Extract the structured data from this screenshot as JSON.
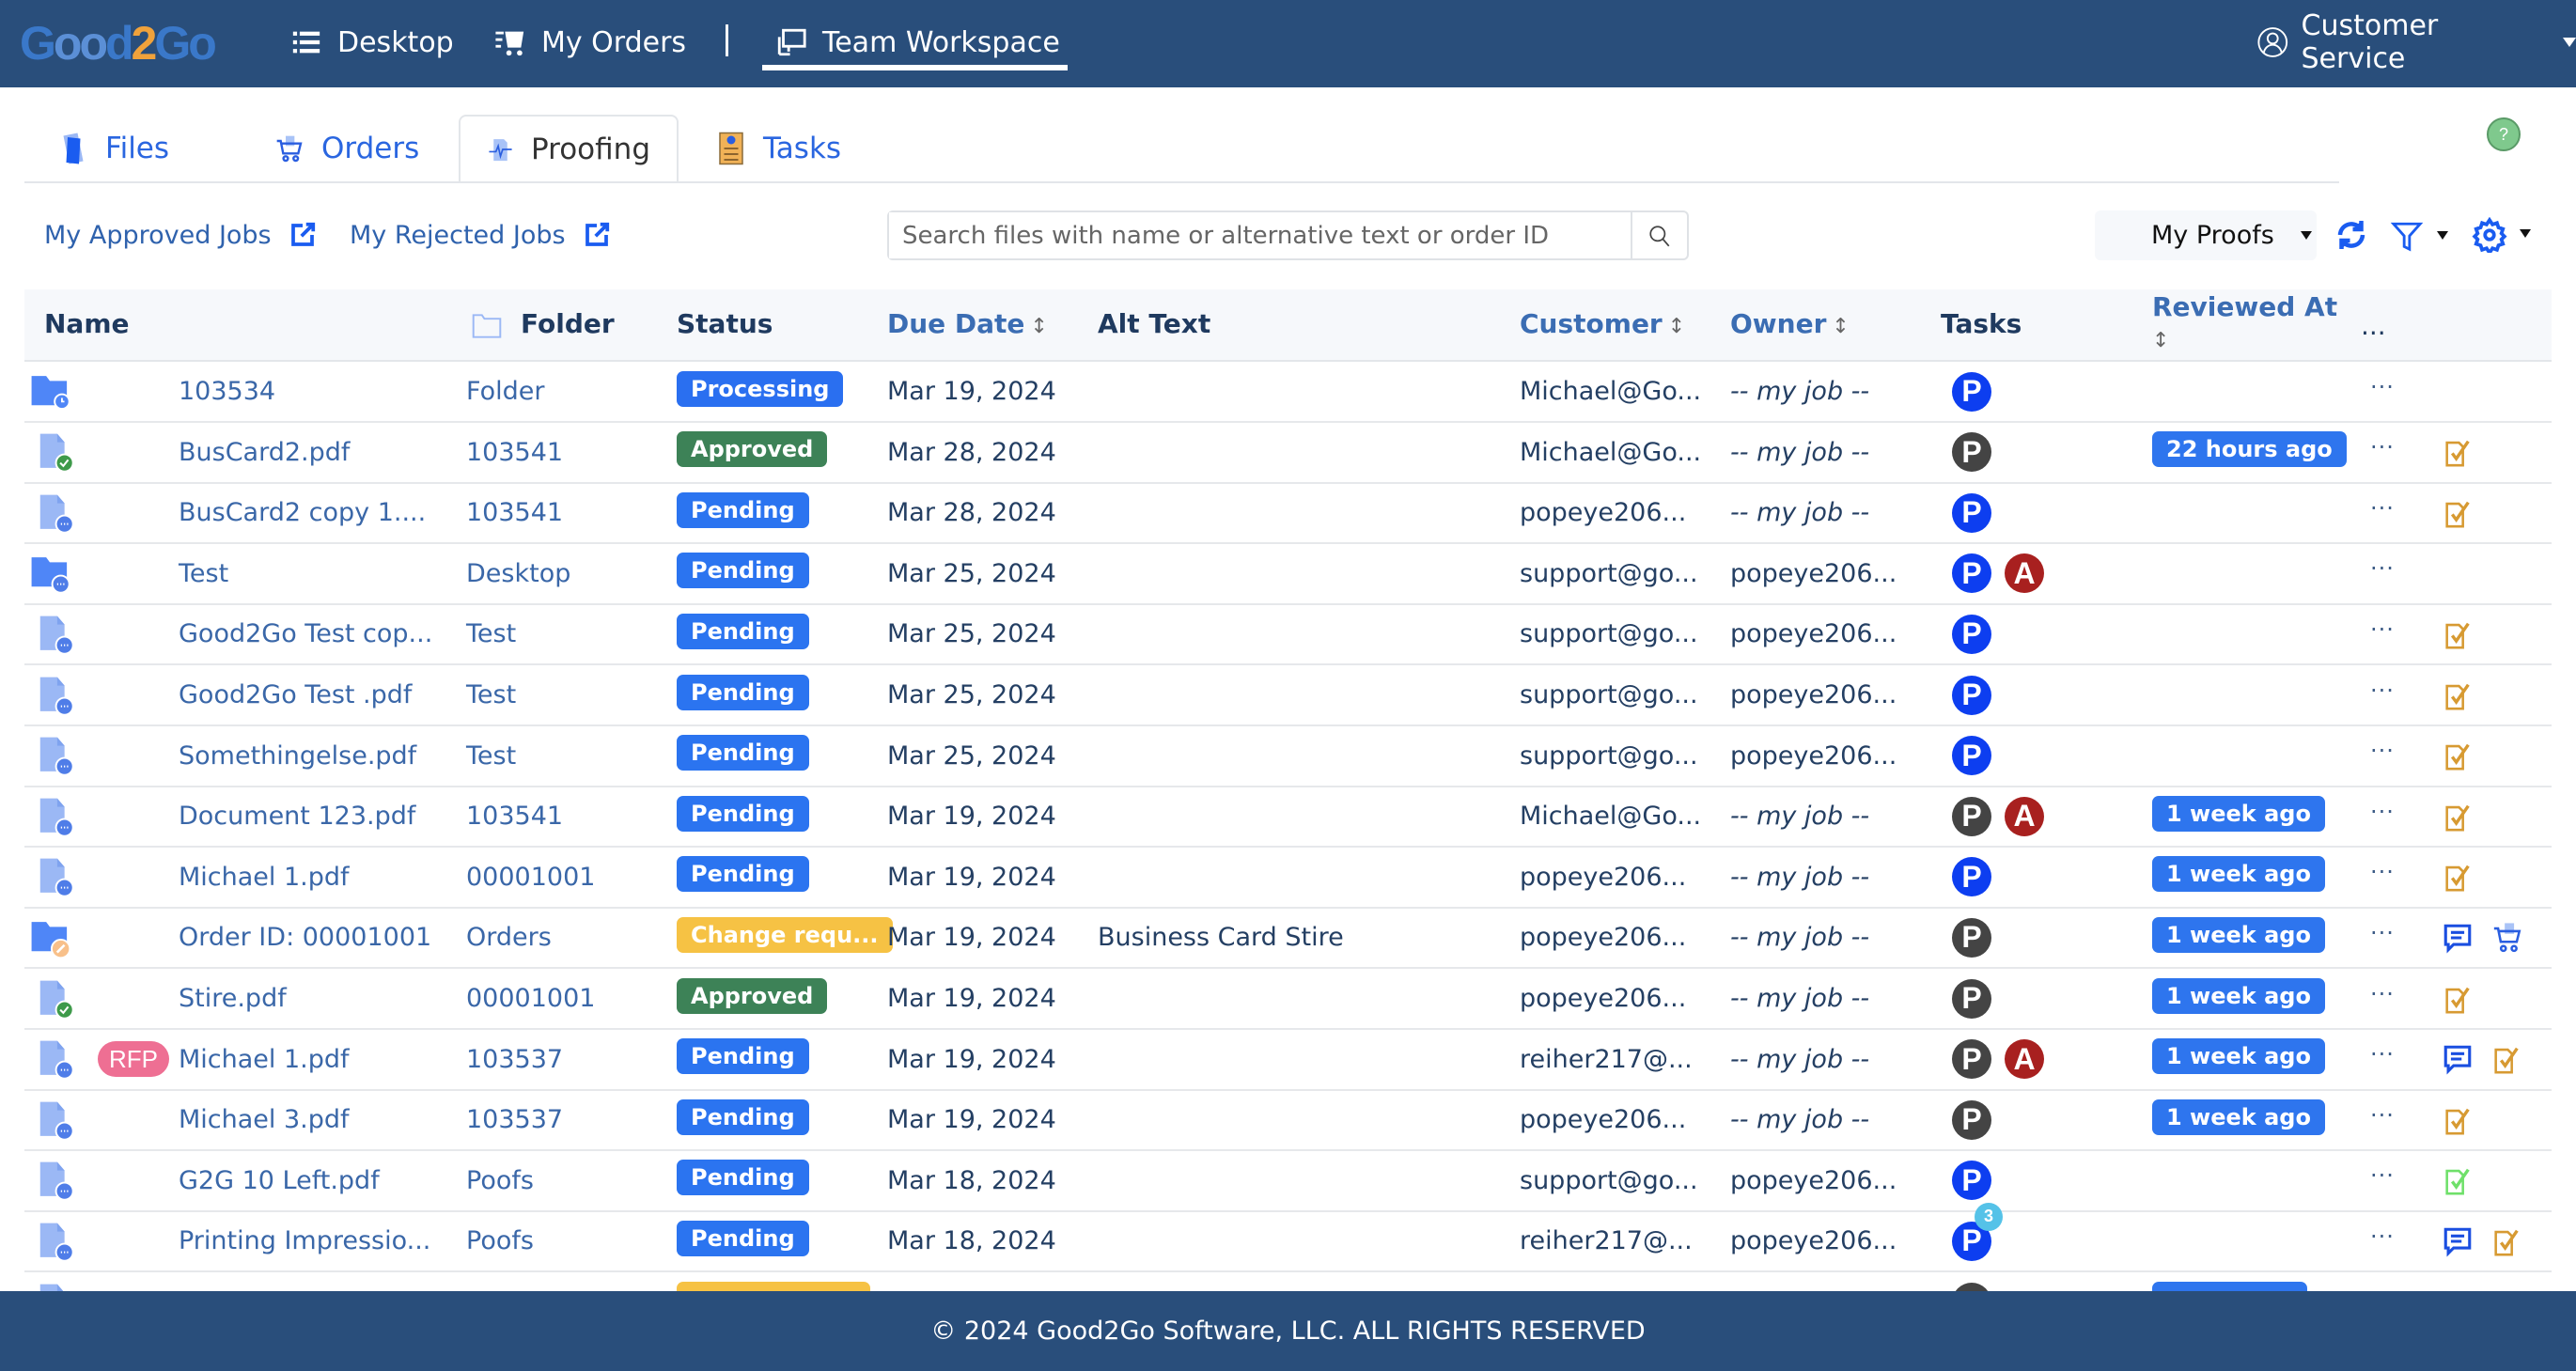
{
  "app": {
    "logo": "Good2Go"
  },
  "nav": {
    "items": [
      {
        "label": "Desktop",
        "icon": "list-icon"
      },
      {
        "label": "My Orders",
        "icon": "orders-cart-icon"
      },
      {
        "label": "Team Workspace",
        "icon": "workspace-icon",
        "active": true
      }
    ],
    "user_label": "Customer Service"
  },
  "tabs": [
    {
      "label": "Files",
      "icon": "files-icon"
    },
    {
      "label": "Orders",
      "icon": "cart-icon"
    },
    {
      "label": "Proofing",
      "icon": "proofing-icon",
      "active": true
    },
    {
      "label": "Tasks",
      "icon": "tasks-icon"
    }
  ],
  "help_label": "?",
  "toolbar": {
    "approved_jobs": "My Approved Jobs",
    "rejected_jobs": "My Rejected Jobs",
    "search_placeholder": "Search files with name or alternative text or order ID",
    "search_value": "",
    "view_select": "My Proofs"
  },
  "colors": {
    "header_bg": "#294e7b",
    "pending": "#2b74f0",
    "processing": "#2a6ff0",
    "approved": "#3d8257",
    "change_requested": "#f6c244",
    "reviewed": "#2e75ee",
    "task_p_active": "#0d3ef0",
    "task_p_done": "#444444",
    "task_a": "#a8201f"
  },
  "table": {
    "columns": [
      "Name",
      "Folder",
      "Status",
      "Due Date",
      "Alt Text",
      "Customer",
      "Owner",
      "Tasks",
      "Reviewed At",
      "..."
    ],
    "sort_arrow": "↕",
    "rows": [
      {
        "icon": "folder-processing",
        "name": "103534",
        "folder": "Folder",
        "status": "Processing",
        "due": "Mar 19, 2024",
        "alt": "",
        "customer": "Michael@Go...",
        "owner": "-- my job --",
        "tasks": [
          {
            "t": "P",
            "s": "active"
          }
        ],
        "reviewed": "",
        "actions": []
      },
      {
        "icon": "file-approved",
        "name": "BusCard2.pdf",
        "folder": "103541",
        "status": "Approved",
        "due": "Mar 28, 2024",
        "alt": "",
        "customer": "Michael@Go...",
        "owner": "-- my job --",
        "tasks": [
          {
            "t": "P",
            "s": "done"
          }
        ],
        "reviewed": "22 hours ago",
        "actions": [
          "approve"
        ]
      },
      {
        "icon": "file-pending",
        "name": "BusCard2 copy 1....",
        "folder": "103541",
        "status": "Pending",
        "due": "Mar 28, 2024",
        "alt": "",
        "customer": "popeye206...",
        "owner": "-- my job --",
        "tasks": [
          {
            "t": "P",
            "s": "active"
          }
        ],
        "reviewed": "",
        "actions": [
          "approve"
        ]
      },
      {
        "icon": "folder-pending",
        "name": "Test",
        "folder": "Desktop",
        "status": "Pending",
        "due": "Mar 25, 2024",
        "alt": "",
        "customer": "support@go...",
        "owner": "popeye206...",
        "tasks": [
          {
            "t": "P",
            "s": "active"
          },
          {
            "t": "A",
            "s": "alert"
          }
        ],
        "reviewed": "",
        "actions": []
      },
      {
        "icon": "file-pending",
        "name": "Good2Go Test cop...",
        "folder": "Test",
        "status": "Pending",
        "due": "Mar 25, 2024",
        "alt": "",
        "customer": "support@go...",
        "owner": "popeye206...",
        "tasks": [
          {
            "t": "P",
            "s": "active"
          }
        ],
        "reviewed": "",
        "actions": [
          "approve"
        ]
      },
      {
        "icon": "file-pending",
        "name": "Good2Go Test .pdf",
        "folder": "Test",
        "status": "Pending",
        "due": "Mar 25, 2024",
        "alt": "",
        "customer": "support@go...",
        "owner": "popeye206...",
        "tasks": [
          {
            "t": "P",
            "s": "active"
          }
        ],
        "reviewed": "",
        "actions": [
          "approve"
        ]
      },
      {
        "icon": "file-pending",
        "name": "Somethingelse.pdf",
        "folder": "Test",
        "status": "Pending",
        "due": "Mar 25, 2024",
        "alt": "",
        "customer": "support@go...",
        "owner": "popeye206...",
        "tasks": [
          {
            "t": "P",
            "s": "active"
          }
        ],
        "reviewed": "",
        "actions": [
          "approve"
        ]
      },
      {
        "icon": "file-pending",
        "name": "Document 123.pdf",
        "folder": "103541",
        "status": "Pending",
        "due": "Mar 19, 2024",
        "alt": "",
        "customer": "Michael@Go...",
        "owner": "-- my job --",
        "tasks": [
          {
            "t": "P",
            "s": "done"
          },
          {
            "t": "A",
            "s": "alert"
          }
        ],
        "reviewed": "1 week ago",
        "actions": [
          "approve"
        ]
      },
      {
        "icon": "file-pending",
        "name": "Michael 1.pdf",
        "folder": "00001001",
        "status": "Pending",
        "due": "Mar 19, 2024",
        "alt": "",
        "customer": "popeye206...",
        "owner": "-- my job --",
        "tasks": [
          {
            "t": "P",
            "s": "active"
          }
        ],
        "reviewed": "1 week ago",
        "actions": [
          "approve"
        ]
      },
      {
        "icon": "folder-change",
        "name": "Order ID: 00001001",
        "folder": "Orders",
        "status": "Change requ...",
        "due": "Mar 19, 2024",
        "alt": "Business Card Stire",
        "customer": "popeye206...",
        "owner": "-- my job --",
        "tasks": [
          {
            "t": "P",
            "s": "done"
          }
        ],
        "reviewed": "1 week ago",
        "actions": [
          "comment",
          "cart"
        ]
      },
      {
        "icon": "file-approved",
        "name": "Stire.pdf",
        "folder": "00001001",
        "status": "Approved",
        "due": "Mar 19, 2024",
        "alt": "",
        "customer": "popeye206...",
        "owner": "-- my job --",
        "tasks": [
          {
            "t": "P",
            "s": "done"
          }
        ],
        "reviewed": "1 week ago",
        "actions": [
          "approve"
        ]
      },
      {
        "icon": "file-pending",
        "tag": "RFP",
        "name": "Michael 1.pdf",
        "folder": "103537",
        "status": "Pending",
        "due": "Mar 19, 2024",
        "alt": "",
        "customer": "reiher217@...",
        "owner": "-- my job --",
        "tasks": [
          {
            "t": "P",
            "s": "done"
          },
          {
            "t": "A",
            "s": "alert"
          }
        ],
        "reviewed": "1 week ago",
        "actions": [
          "comment",
          "approve"
        ]
      },
      {
        "icon": "file-pending",
        "name": "Michael 3.pdf",
        "folder": "103537",
        "status": "Pending",
        "due": "Mar 19, 2024",
        "alt": "",
        "customer": "popeye206...",
        "owner": "-- my job --",
        "tasks": [
          {
            "t": "P",
            "s": "done"
          }
        ],
        "reviewed": "1 week ago",
        "actions": [
          "approve"
        ]
      },
      {
        "icon": "file-pending",
        "name": "G2G 10 Left.pdf",
        "folder": "Poofs",
        "status": "Pending",
        "due": "Mar 18, 2024",
        "alt": "",
        "customer": "support@go...",
        "owner": "popeye206...",
        "tasks": [
          {
            "t": "P",
            "s": "active"
          }
        ],
        "reviewed": "",
        "actions": [
          "approve-done"
        ]
      },
      {
        "icon": "file-pending",
        "name": "Printing Impressio...",
        "folder": "Poofs",
        "status": "Pending",
        "due": "Mar 18, 2024",
        "alt": "",
        "customer": "reiher217@...",
        "owner": "popeye206...",
        "tasks": [
          {
            "t": "P",
            "s": "active",
            "count": "3"
          }
        ],
        "reviewed": "",
        "actions": [
          "comment",
          "approve"
        ]
      }
    ],
    "row_more": "···"
  },
  "footer": "© 2024 Good2Go Software, LLC. ALL RIGHTS RESERVED"
}
